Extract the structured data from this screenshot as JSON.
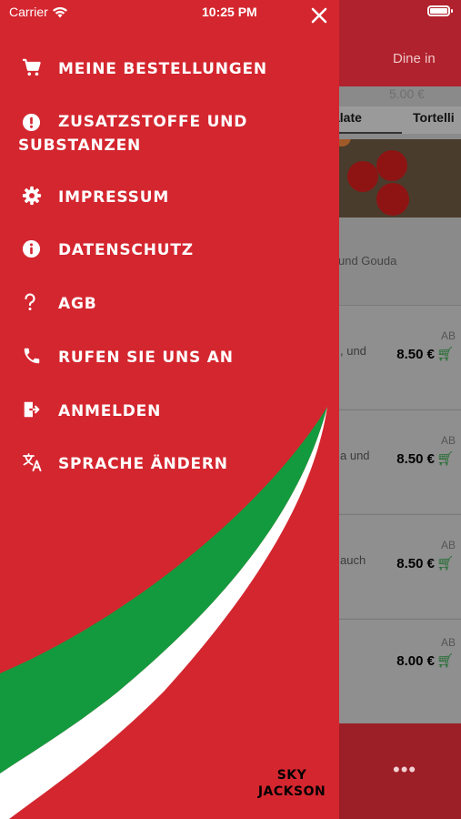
{
  "status_bar": {
    "carrier": "Carrier",
    "time": "10:25 PM"
  },
  "drawer": {
    "close_icon": "close-icon",
    "menu": [
      {
        "label": "MEINE BESTELLUNGEN",
        "icon": "cart-icon"
      },
      {
        "label_line1": "ZUSATZSTOFFE UND",
        "label_line2": "SUBSTANZEN",
        "icon": "alert-icon"
      },
      {
        "label": "IMPRESSUM",
        "icon": "gear-icon"
      },
      {
        "label": "DATENSCHUTZ",
        "icon": "info-icon"
      },
      {
        "label": "AGB",
        "icon": "question-icon"
      },
      {
        "label": "RUFEN SIE UNS AN",
        "icon": "phone-icon"
      },
      {
        "label": "ANMELDEN",
        "icon": "login-icon"
      },
      {
        "label": "SPRACHE ÄNDERN",
        "icon": "translate-icon"
      }
    ],
    "brand_line1": "SKY",
    "brand_line2": "JACKSON"
  },
  "background_app": {
    "header_mode": "Dine in",
    "top_price": "5.00 €",
    "tabs": [
      "alate",
      "Tortelli"
    ],
    "featured_desc": "und Gouda",
    "items": [
      {
        "desc": ", und",
        "ab": "AB",
        "price": "8.50 €"
      },
      {
        "desc": "a und",
        "ab": "AB",
        "price": "8.50 €"
      },
      {
        "desc": "auch",
        "ab": "AB",
        "price": "8.50 €"
      },
      {
        "desc": "",
        "ab": "AB",
        "price": "8.00 €"
      }
    ],
    "more_label": "•••"
  },
  "colors": {
    "drawer_red": "#d4262f",
    "italian_green": "#149a3e",
    "header_red": "#b0222d"
  }
}
